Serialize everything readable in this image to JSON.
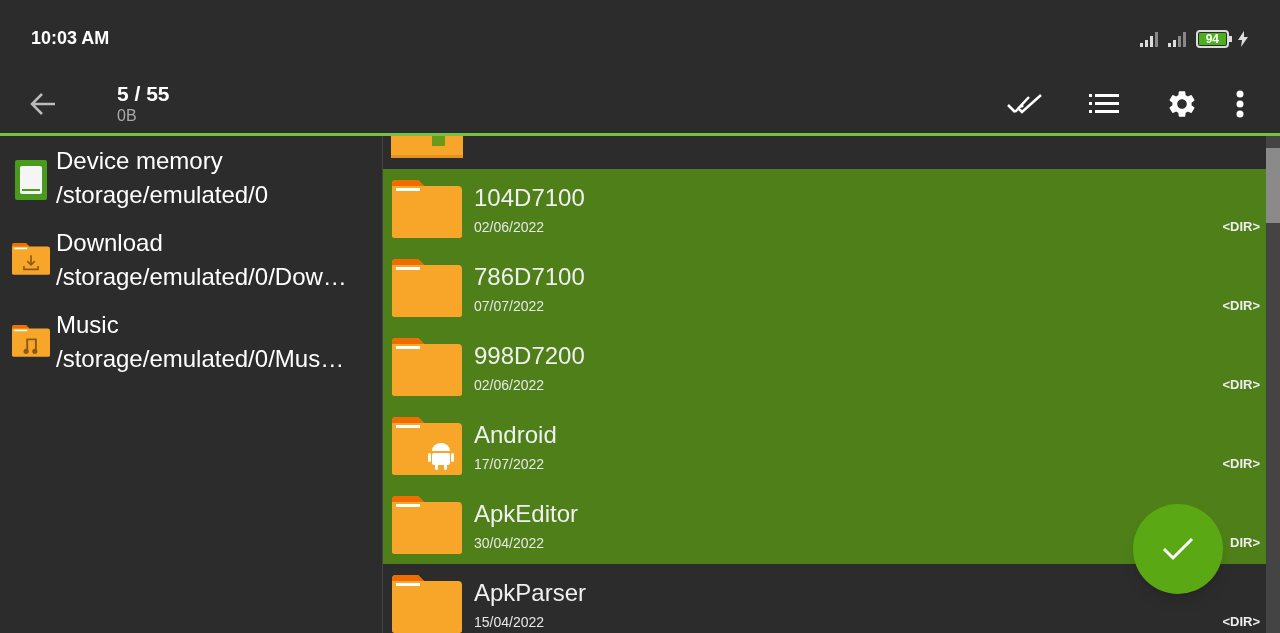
{
  "status_bar": {
    "time": "10:03 AM",
    "battery": "94"
  },
  "app_bar": {
    "title": "5 / 55",
    "subtitle": "0B"
  },
  "sidebar": {
    "items": [
      {
        "kind": "storage",
        "name": "Device memory",
        "path": "/storage/emulated/0"
      },
      {
        "kind": "download",
        "name": "Download",
        "path": "/storage/emulated/0/Dow…"
      },
      {
        "kind": "music",
        "name": "Music",
        "path": "/storage/emulated/0/Mus…"
      }
    ]
  },
  "files": [
    {
      "kind": "folder",
      "name": "104D7100",
      "date": "02/06/2022",
      "type": "<DIR>",
      "selected": true
    },
    {
      "kind": "folder",
      "name": "786D7100",
      "date": "07/07/2022",
      "type": "<DIR>",
      "selected": true
    },
    {
      "kind": "folder",
      "name": "998D7200",
      "date": "02/06/2022",
      "type": "<DIR>",
      "selected": true
    },
    {
      "kind": "android",
      "name": "Android",
      "date": "17/07/2022",
      "type": "<DIR>",
      "selected": true
    },
    {
      "kind": "folder",
      "name": "ApkEditor",
      "date": "30/04/2022",
      "type": "DIR>",
      "selected": true
    },
    {
      "kind": "folder",
      "name": "ApkParser",
      "date": "15/04/2022",
      "type": "<DIR>",
      "selected": false
    }
  ]
}
